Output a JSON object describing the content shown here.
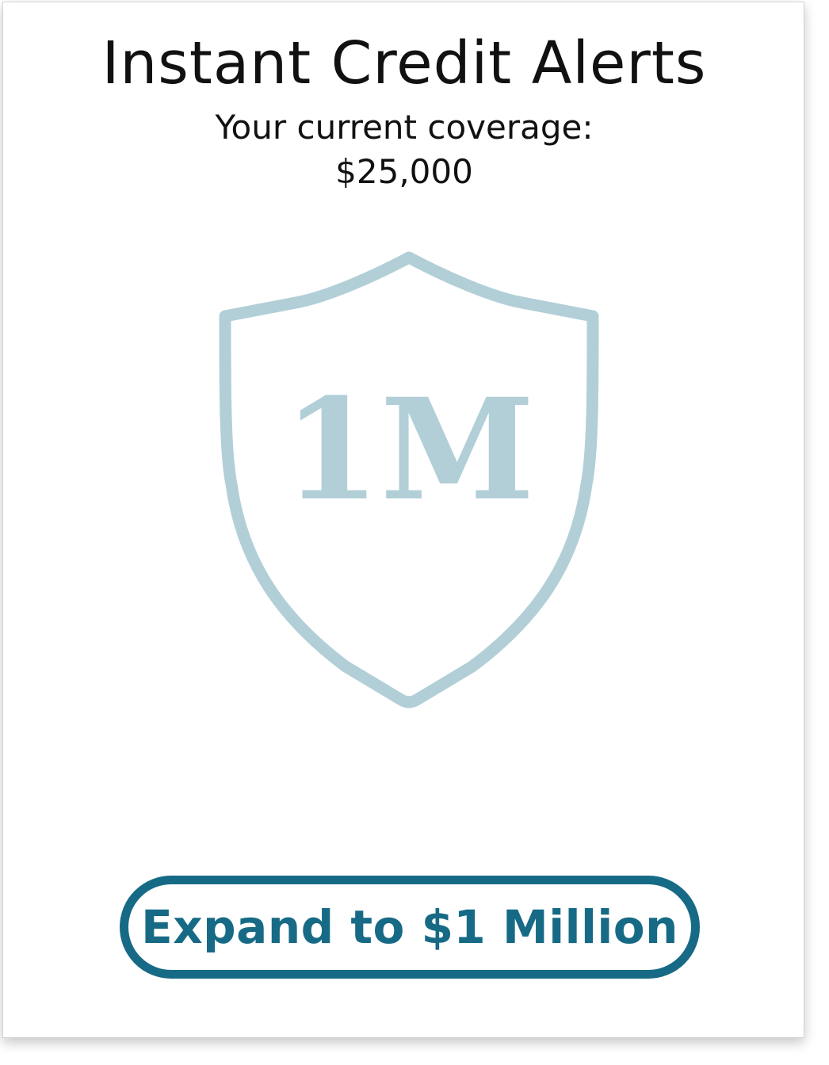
{
  "header": {
    "title": "Instant Credit Alerts",
    "coverage_label": "Your current coverage:",
    "coverage_value": "$25,000"
  },
  "badge": {
    "icon": "shield-icon",
    "text": "1M",
    "color": "#b2cfd8"
  },
  "cta": {
    "label": "Expand to $1 Million",
    "color": "#176a85"
  }
}
